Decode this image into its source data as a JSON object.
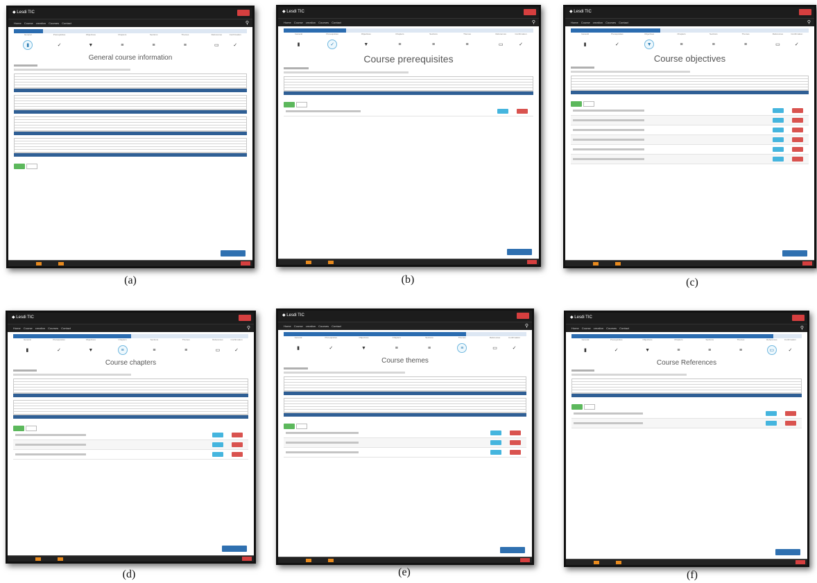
{
  "panels": [
    {
      "caption": "(a)",
      "page_title": "General course information",
      "active_step": 0,
      "app_name": "Lesdi TIC"
    },
    {
      "caption": "(b)",
      "page_title": "Course prerequisites",
      "active_step": 1,
      "app_name": "Lesdi TIC"
    },
    {
      "caption": "(c)",
      "page_title": "Course objectives",
      "active_step": 2,
      "app_name": "Lesdi TIC"
    },
    {
      "caption": "(d)",
      "page_title": "Course chapters",
      "active_step": 3,
      "app_name": "Lesdi TIC"
    },
    {
      "caption": "(e)",
      "page_title": "Course themes",
      "active_step": 5,
      "app_name": "Lesdi TIC"
    },
    {
      "caption": "(f)",
      "page_title": "Course References",
      "active_step": 6,
      "app_name": "Lesdi TIC"
    }
  ],
  "steps": [
    {
      "label": "General",
      "icon": "document-icon",
      "glyph": "▮"
    },
    {
      "label": "Prerequisites",
      "icon": "check-icon",
      "glyph": "✓"
    },
    {
      "label": "Objectives",
      "icon": "trophy-icon",
      "glyph": "▼"
    },
    {
      "label": "Chapters",
      "icon": "list-icon",
      "glyph": "≡"
    },
    {
      "label": "Sections",
      "icon": "list-icon",
      "glyph": "≡"
    },
    {
      "label": "Themes",
      "icon": "list-icon",
      "glyph": "≡"
    },
    {
      "label": "References",
      "icon": "book-icon",
      "glyph": "▭"
    },
    {
      "label": "Confirmation",
      "icon": "check-icon",
      "glyph": "✓"
    }
  ],
  "menu": "Home  Course creation  Courses  Contact",
  "search_icon": "⚲"
}
